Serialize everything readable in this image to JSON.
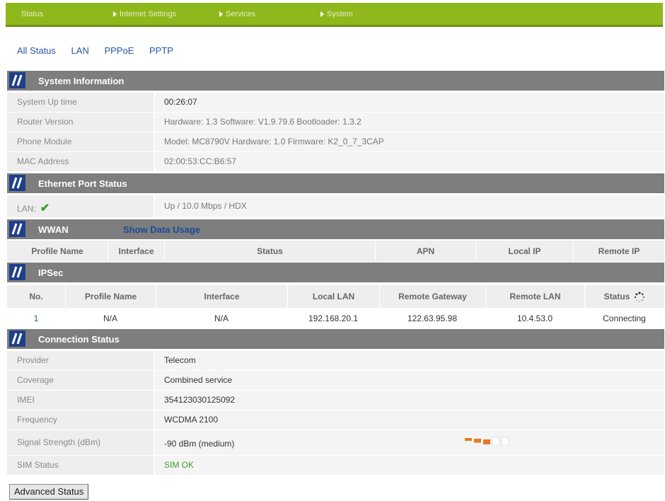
{
  "topnav": {
    "items": [
      {
        "label": "Status",
        "arrow": false
      },
      {
        "label": "Internet Settings",
        "arrow": true
      },
      {
        "label": "Services",
        "arrow": true
      },
      {
        "label": "System",
        "arrow": true
      }
    ]
  },
  "subnav": {
    "items": [
      "All Status",
      "LAN",
      "PPPoE",
      "PPTP"
    ]
  },
  "system_info": {
    "title": "System Information",
    "rows": [
      {
        "label": "System Up time",
        "value": "00:26:07"
      },
      {
        "label": "Router Version",
        "value": "Hardware: 1.3   Software: V1.9.79.6   Bootloader: 1.3.2"
      },
      {
        "label": "Phone Module",
        "value": "Model: MC8790V   Hardware: 1.0   Firmware: K2_0_7_3CAP"
      },
      {
        "label": "MAC Address",
        "value": "02:00:53:CC:B6:57"
      }
    ]
  },
  "ethernet": {
    "title": "Ethernet Port Status",
    "label": "LAN:",
    "check": "✔",
    "value": "Up / 10.0 Mbps / HDX"
  },
  "wwan": {
    "title": "WWAN",
    "link": "Show Data Usage",
    "headers": [
      "Profile Name",
      "Interface",
      "Status",
      "APN",
      "Local IP",
      "Remote IP"
    ]
  },
  "ipsec": {
    "title": "IPSec",
    "headers": [
      "No.",
      "Profile Name",
      "Interface",
      "Local LAN",
      "Remote Gateway",
      "Remote LAN",
      "Status"
    ],
    "rows": [
      [
        "1",
        "N/A",
        "N/A",
        "192.168.20.1",
        "122.63.95.98",
        "10.4.53.0",
        "Connecting"
      ]
    ]
  },
  "connection": {
    "title": "Connection Status",
    "rows": [
      {
        "label": "Provider",
        "value": "Telecom"
      },
      {
        "label": "Coverage",
        "value": "Combined service"
      },
      {
        "label": "IMEI",
        "value": "354123030125092"
      },
      {
        "label": "Frequency",
        "value": "WCDMA 2100"
      },
      {
        "label": "Signal Strength (dBm)",
        "value": "-90 dBm (medium)"
      },
      {
        "label": "SIM Status",
        "value": "SIM OK"
      }
    ],
    "signal_bars_lit": 3,
    "signal_bars_total": 5,
    "colors": {
      "signal_on": "#e87722",
      "signal_off": "#dddddd",
      "sim_ok": "#3f9a2c"
    }
  },
  "advanced_button": "Advanced Status"
}
